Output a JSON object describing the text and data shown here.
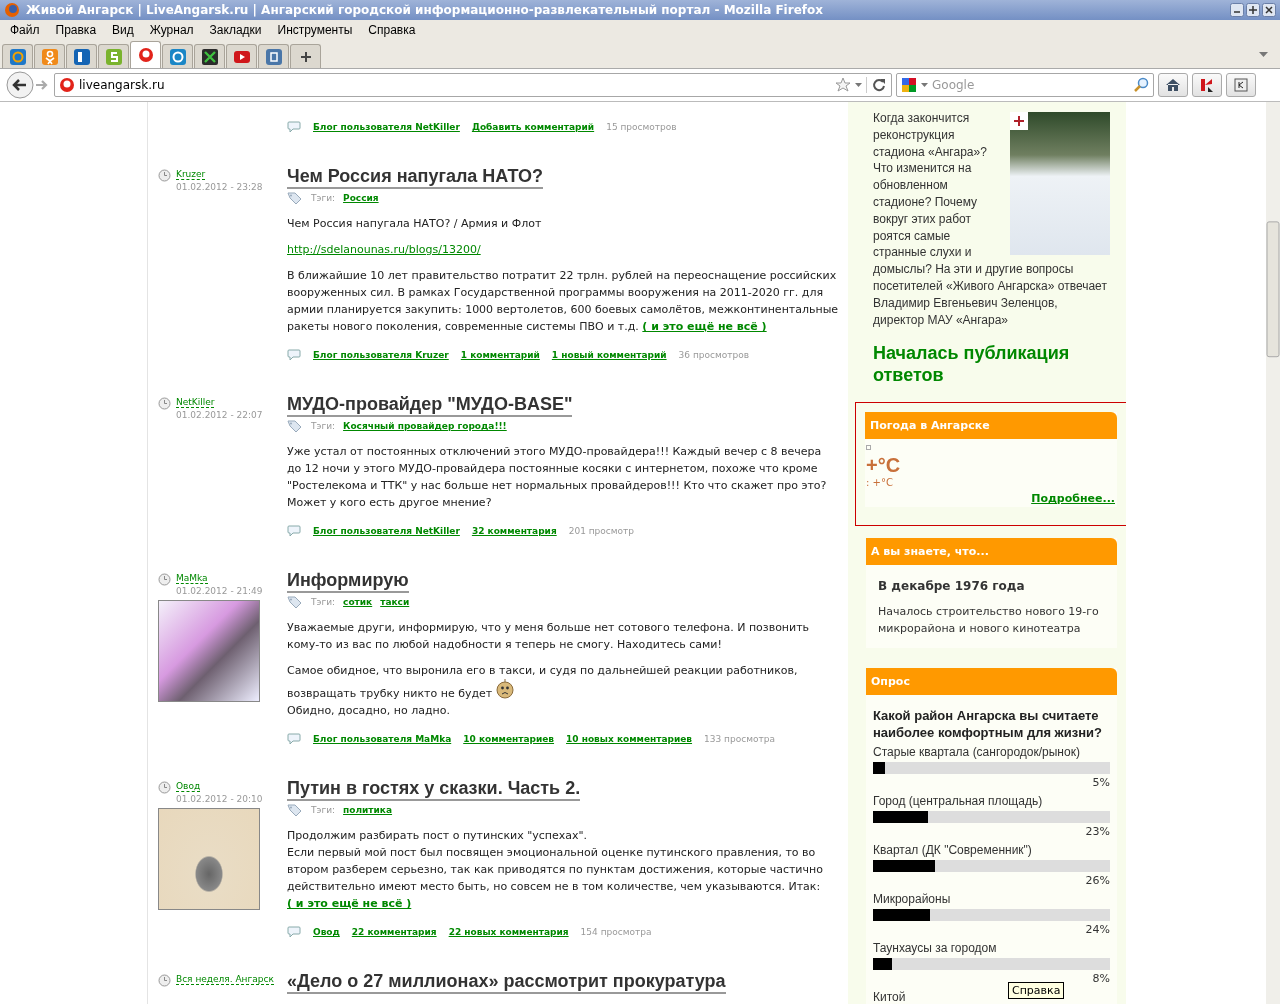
{
  "window": {
    "title": "Живой Ангарск | LiveAngarsk.ru | Ангарский городской информационно-развлекательный портал - Mozilla Firefox"
  },
  "menu": [
    "Файл",
    "Правка",
    "Вид",
    "Журнал",
    "Закладки",
    "Инструменты",
    "Справка"
  ],
  "tabs": [
    {
      "kind": "mail",
      "selected": false
    },
    {
      "kind": "ok",
      "selected": false
    },
    {
      "kind": "d",
      "selected": false
    },
    {
      "kind": "s",
      "selected": false
    },
    {
      "kind": "site",
      "selected": true
    },
    {
      "kind": "ring",
      "selected": false
    },
    {
      "kind": "fx",
      "selected": false
    },
    {
      "kind": "video",
      "selected": false
    },
    {
      "kind": "vk",
      "selected": false
    }
  ],
  "address": {
    "value": "liveangarsk.ru"
  },
  "search": {
    "placeholder": "Google"
  },
  "posts": [
    {
      "footer": {
        "links": [
          "Блог пользователя NetKiller",
          "Добавить комментарий"
        ],
        "views": "15 просмотров"
      }
    },
    {
      "author": "Kruzer",
      "date": "01.02.2012 - 23:28",
      "title": "Чем Россия напугала НАТО?",
      "tags_label": "Тэги:",
      "tags": [
        "Россия"
      ],
      "paragraphs": [
        {
          "kind": "text",
          "lines": [
            {
              "text": "Чем Россия напугала НАТО? / Армия и Флот"
            }
          ]
        },
        {
          "kind": "url",
          "lines": [
            {
              "text": "http://sdelanounas.ru/blogs/13200/"
            }
          ]
        },
        {
          "kind": "text",
          "lines": [
            {
              "text": "В ближайшие 10 лет правительство потратит 22 трлн. рублей на переоснащение российских вооруженных сил. В рамках Государственной программы вооружения на 2011-2020 гг. для армии планируется закупить: 1000 вертолетов, 600 боевых самолётов, межконтинентальные ракеты нового поколения, современные системы ПВО и т.д."
            }
          ],
          "more": "( и это ещё не всё )"
        }
      ],
      "footer": {
        "links": [
          "Блог пользователя Kruzer",
          "1 комментарий",
          "1 новый комментарий"
        ],
        "views": "36 просмотров"
      }
    },
    {
      "author": "NetKiller",
      "date": "01.02.2012 - 22:07",
      "title": "МУДО-провайдер \"МУДО-BASE\"",
      "tags_label": "Тэги:",
      "tags": [
        "Косячный провайдер города!!!"
      ],
      "paragraphs": [
        {
          "kind": "text",
          "lines": [
            {
              "text": "Уже устал от постоянных отключений этого МУДО-провайдера!!! Каждый вечер с 8 вечера до 12 ночи у этого МУДО-провайдера постоянные косяки с интернетом, похоже что кроме \"Ростелекома и ТТК\" у нас больше нет нормальных провайдеров!!! Кто что скажет про это? Может у кого есть другое мнение?"
            }
          ]
        }
      ],
      "footer": {
        "links": [
          "Блог пользователя NetKiller",
          "32 комментария"
        ],
        "views": "201 просмотр"
      }
    },
    {
      "author": "MaMka",
      "date": "01.02.2012 - 21:49",
      "avatar": {
        "kind": "cat"
      },
      "title": "Информирую",
      "tags_label": "Тэги:",
      "tags": [
        "сотик",
        "такси"
      ],
      "paragraphs": [
        {
          "kind": "text",
          "lines": [
            {
              "text": "Уважаемые други, информирую, что у меня больше нет сотового телефона. И позвонить кому-то из вас по любой надобности я теперь не смогу. Находитесь сами!"
            }
          ]
        },
        {
          "kind": "text",
          "lines": [
            {
              "text": "Самое обидное, что выронила его в такси, и судя по дальнейшей реакции работников, возвращать трубку никто не будет",
              "emoticon": true
            },
            {
              "text": "Обидно, досадно, но ладно."
            }
          ]
        }
      ],
      "footer": {
        "links": [
          "Блог пользователя MaMka",
          "10 комментариев",
          "10 новых комментариев"
        ],
        "views": "133 просмотра"
      }
    },
    {
      "author": "Овод",
      "date": "01.02.2012 - 20:10",
      "avatar": {
        "kind": "book"
      },
      "title": "Путин в гостях у сказки. Часть 2.",
      "tags_label": "Тэги:",
      "tags": [
        "политика"
      ],
      "paragraphs": [
        {
          "kind": "text",
          "lines": [
            {
              "text": "Продолжим разбирать пост о путинских \"успехах\"."
            },
            {
              "text": "Если первый мой пост был посвящен эмоциональной оценке путинского правления, то во втором разберем серьезно, так как приводятся по пунктам достижения, которые частично действительно имеют место быть, но совсем не в том количестве, чем указываются. Итак:"
            }
          ],
          "more": "( и это ещё не всё )"
        }
      ],
      "footer": {
        "links": [
          "Овод",
          "22 комментария",
          "22 новых комментария"
        ],
        "views": "154 просмотра"
      }
    },
    {
      "author": "Вся неделя. Ангарск",
      "title": "«Дело о 27 миллионах» рассмотрит прокуратура"
    }
  ],
  "interview": {
    "text_beside": "Когда закончится реконструкция стадиона «Ангара»? Что изменится на обновленном стадионе? Почему вокруг этих работ роятся самые странные слухи и",
    "text_below": "домыслы? На эти и другие вопросы посетителей «Живого Ангарска» отвечает Владимир Евгеньевич Зеленцов, директор МАУ «Ангара»",
    "headline": "Началась публикация ответов"
  },
  "weather": {
    "title": "Погода в Ангарске",
    "temperature": "+°C",
    "detail": ": +°C",
    "more": "Подробнее..."
  },
  "did_you_know": {
    "title": "А вы знаете, что...",
    "heading": "В декабре 1976 года",
    "text": "Началось строительство нового 19-го микрорайона и нового кинотеатра"
  },
  "poll": {
    "title": "Опрос",
    "question": "Какой район Ангарска вы считаете наиболее комфортным для жизни?",
    "options": [
      {
        "label": "Старые квартала (сангородок/рынок)",
        "level": 0.05,
        "percent": "5%"
      },
      {
        "label": "Город (центральная площадь)",
        "level": 0.23,
        "percent": "23%"
      },
      {
        "label": "Квартал (ДК \"Современник\")",
        "level": 0.26,
        "percent": "26%"
      },
      {
        "label": "Микрорайоны",
        "level": 0.24,
        "percent": "24%"
      },
      {
        "label": "Таунхаусы за городом",
        "level": 0.08,
        "percent": "8%"
      },
      {
        "label": "Китой"
      }
    ]
  },
  "tooltip": "Справка"
}
